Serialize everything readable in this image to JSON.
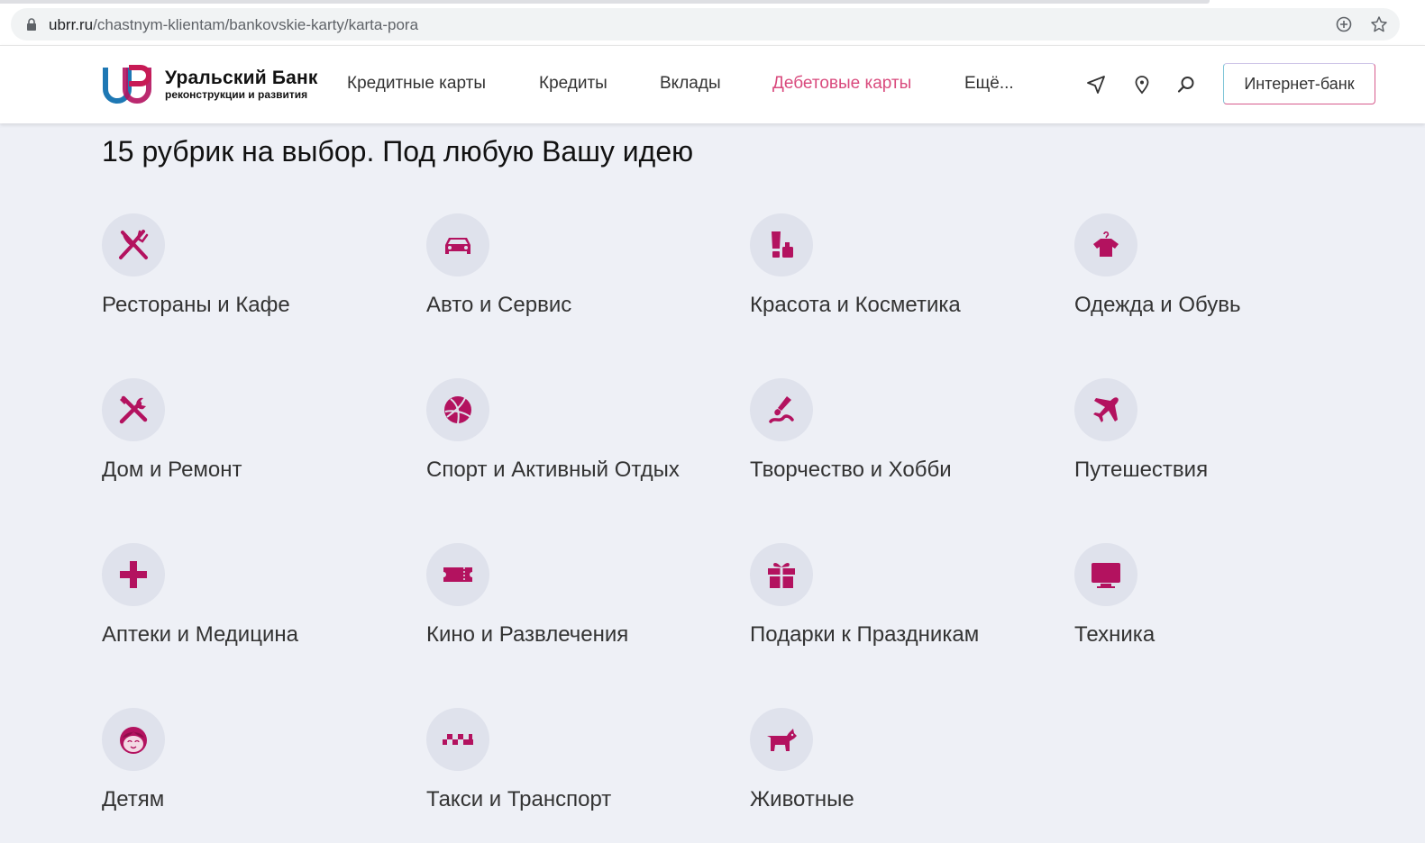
{
  "browser": {
    "url_domain": "ubrr.ru",
    "url_path": "/chastnym-klientam/bankovskie-karty/karta-pora",
    "icons": [
      "lock-icon",
      "add-circle-icon",
      "star-icon"
    ]
  },
  "header": {
    "logo_title": "Уральский Банк",
    "logo_subtitle": "реконструкции и развития",
    "nav": [
      {
        "label": "Кредитные карты"
      },
      {
        "label": "Кредиты"
      },
      {
        "label": "Вклады"
      },
      {
        "label": "Дебетовые карты",
        "active": true
      },
      {
        "label": "Ещё..."
      }
    ],
    "icons": [
      "navigation-arrow-icon",
      "location-pin-icon",
      "search-icon"
    ],
    "internet_bank_label": "Интернет-банк",
    "active_color": "#d94a7d"
  },
  "section_title": "15 рубрик на выбор. Под любую Вашу идею",
  "accent_color": "#b3125f",
  "categories": [
    {
      "label": "Рестораны и Кафе",
      "icon": "fork-knife-icon"
    },
    {
      "label": "Авто и Сервис",
      "icon": "car-icon"
    },
    {
      "label": "Красота и Косметика",
      "icon": "cosmetics-icon"
    },
    {
      "label": "Одежда и Обувь",
      "icon": "shirt-hanger-icon"
    },
    {
      "label": "Дом и Ремонт",
      "icon": "tools-icon"
    },
    {
      "label": "Спорт и Активный Отдых",
      "icon": "ball-icon"
    },
    {
      "label": "Творчество и Хобби",
      "icon": "brush-icon"
    },
    {
      "label": "Путешествия",
      "icon": "airplane-icon"
    },
    {
      "label": "Аптеки и Медицина",
      "icon": "medical-cross-icon"
    },
    {
      "label": "Кино и Развлечения",
      "icon": "ticket-icon"
    },
    {
      "label": "Подарки к Праздникам",
      "icon": "gift-icon"
    },
    {
      "label": "Техника",
      "icon": "monitor-icon"
    },
    {
      "label": "Детям",
      "icon": "child-face-icon"
    },
    {
      "label": "Такси и Транспорт",
      "icon": "taxi-checker-icon"
    },
    {
      "label": "Животные",
      "icon": "dog-icon"
    }
  ]
}
